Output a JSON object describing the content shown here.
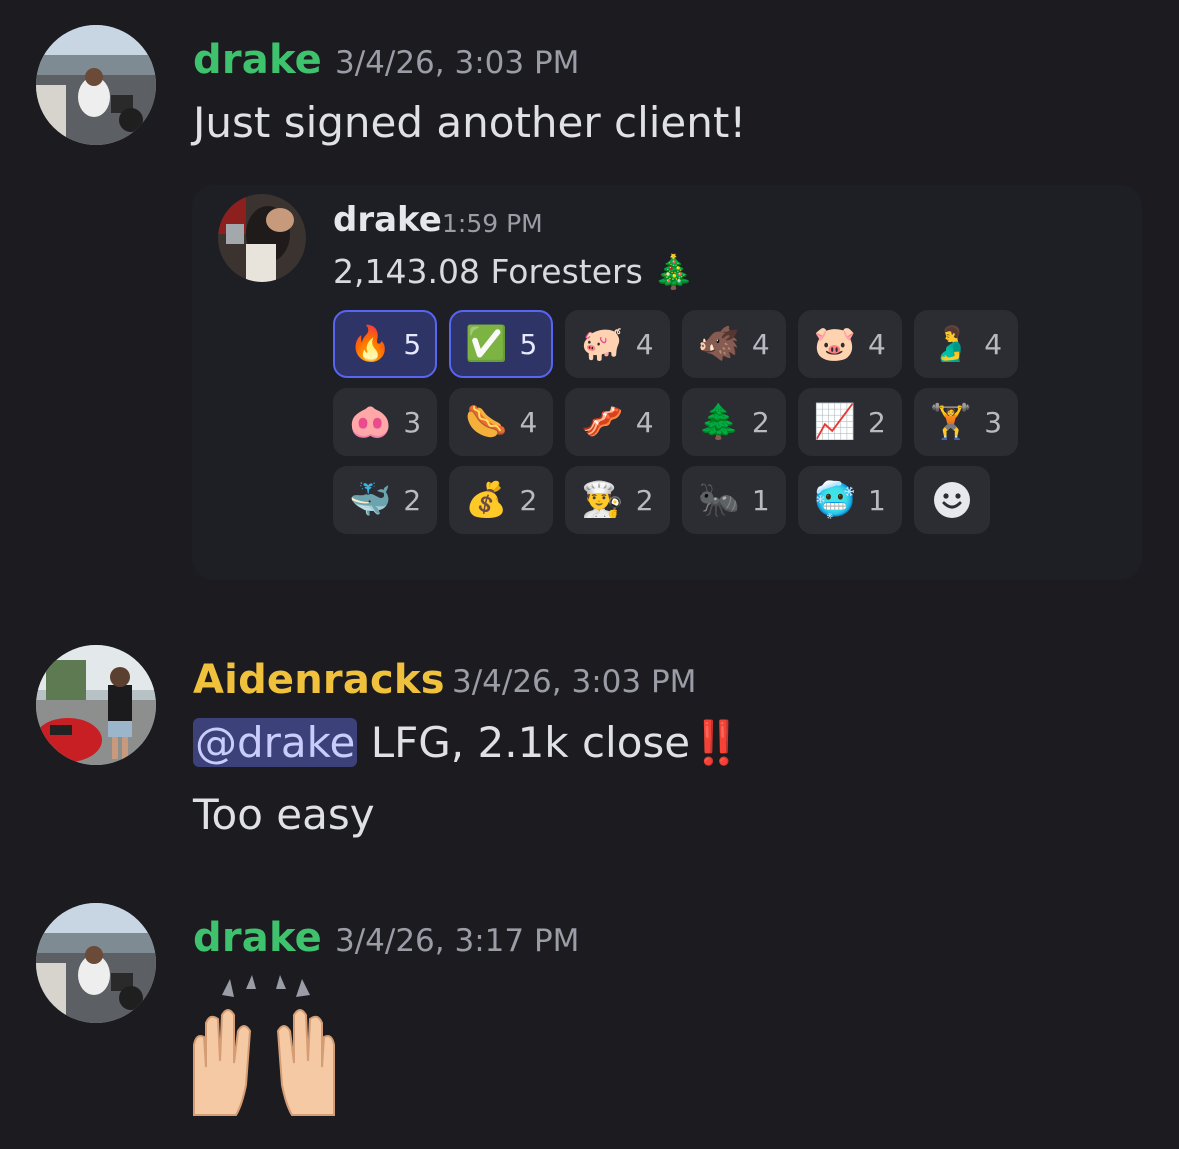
{
  "messages": [
    {
      "username": "drake",
      "name_color": "#3ec26d",
      "timestamp": "3/4/26, 3:03 PM",
      "text": "Just signed another client!",
      "forwarded": {
        "username": "drake",
        "timestamp": "1:59 PM",
        "text": "2,143.08 Foresters",
        "text_emoji": "🎄",
        "reactions": [
          {
            "emoji": "🔥",
            "count": "5",
            "active": true
          },
          {
            "emoji": "✅",
            "count": "5",
            "active": true
          },
          {
            "emoji": "🐖",
            "count": "4",
            "active": false
          },
          {
            "emoji": "🐗",
            "count": "4",
            "active": false
          },
          {
            "emoji": "🐷",
            "count": "4",
            "active": false
          },
          {
            "emoji": "🫃",
            "count": "4",
            "active": false
          },
          {
            "emoji": "🐽",
            "count": "3",
            "active": false
          },
          {
            "emoji": "🌭",
            "count": "4",
            "active": false
          },
          {
            "emoji": "🥓",
            "count": "4",
            "active": false
          },
          {
            "emoji": "🌲",
            "count": "2",
            "active": false
          },
          {
            "emoji": "📈",
            "count": "2",
            "active": false
          },
          {
            "emoji": "🏋️",
            "count": "3",
            "active": false
          },
          {
            "emoji": "🐳",
            "count": "2",
            "active": false
          },
          {
            "emoji": "💰",
            "count": "2",
            "active": false
          },
          {
            "emoji": "👨‍🍳",
            "count": "2",
            "active": false
          },
          {
            "emoji": "🐜",
            "count": "1",
            "active": false
          },
          {
            "emoji": "🥶",
            "count": "1",
            "active": false
          }
        ],
        "add_reaction_icon": "smiley-add-icon"
      }
    },
    {
      "username": "Aidenracks",
      "name_color": "#f0c13c",
      "timestamp": "3/4/26, 3:03 PM",
      "mention": "@drake",
      "text_after_mention": " LFG, 2.1k close",
      "text_emoji": "‼️",
      "text2": "Too easy"
    },
    {
      "username": "drake",
      "name_color": "#3ec26d",
      "timestamp": "3/4/26, 3:17 PM",
      "big_emoji": "🙌"
    }
  ]
}
